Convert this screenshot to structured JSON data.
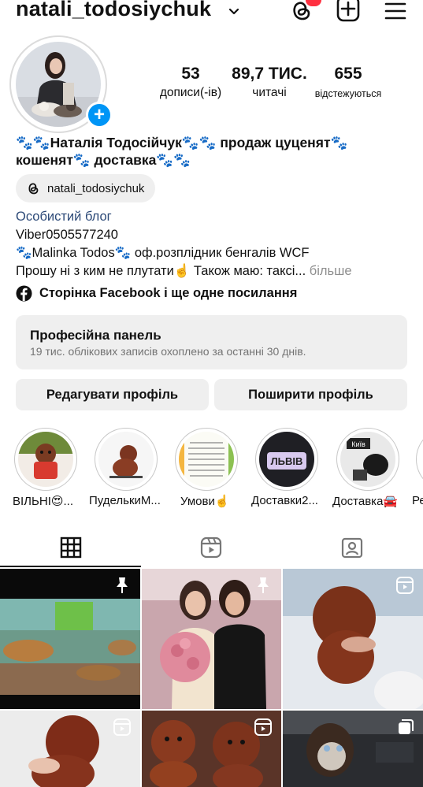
{
  "header": {
    "username": "natali_todosiychuk",
    "icons": [
      "chevron-down-icon",
      "threads-icon",
      "new-post-icon",
      "menu-icon"
    ]
  },
  "profile": {
    "stats": [
      {
        "value": "53",
        "label": "дописи(-ів)"
      },
      {
        "value": "89,7 ТИС.",
        "label": "читачі"
      },
      {
        "value": "655",
        "label": "відстежуються"
      }
    ],
    "name_line1": "🐾🐾Наталія Тодосійчук🐾🐾 продаж цуценят🐾",
    "name_line2": "кошенят🐾 доставка🐾🐾",
    "threads_handle": "natali_todosiychuk",
    "category": "Особистий блог",
    "bio_lines": [
      "Viber0505577240",
      "🐾Malinka Todos🐾 оф.розплідник бенгалів WCF",
      "Прошу ні з ким не плутати☝️ Також маю: таксі..."
    ],
    "more_label": "більше",
    "facebook_link": "Сторінка Facebook і ще одне посилання"
  },
  "pro_panel": {
    "title": "Професійна панель",
    "subtitle": "19 тис. облікових записів охоплено за останні 30 днів."
  },
  "buttons": {
    "edit": "Редагувати профіль",
    "share": "Поширити профіль"
  },
  "highlights": [
    {
      "label": "ВІЛЬНІ😍..."
    },
    {
      "label": "ПуделькиМ..."
    },
    {
      "label": "Умови☝️"
    },
    {
      "label": "Доставки2..."
    },
    {
      "label": "Доставка🚘"
    },
    {
      "label": "Ре"
    }
  ],
  "highlight_texts": {
    "lviv": "ЛЬВІВ",
    "kyiv": "Київ"
  },
  "tabs": [
    "grid-tab",
    "reels-tab",
    "tagged-tab"
  ],
  "colors": {
    "accent_blue": "#0095f6",
    "category_blue": "#2d4a78",
    "panel_gray": "#efefef",
    "notification_red": "#ff3040"
  }
}
